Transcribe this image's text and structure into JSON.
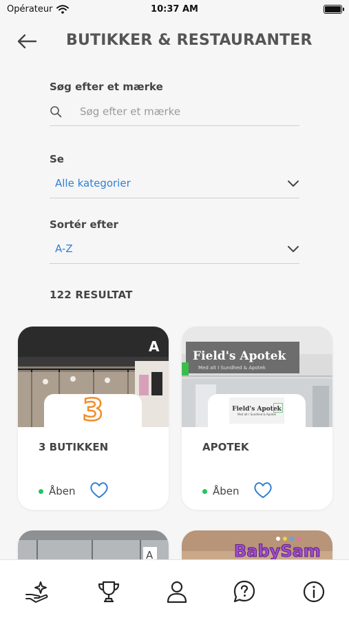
{
  "status_bar": {
    "carrier": "Opérateur",
    "time": "10:37 AM"
  },
  "header": {
    "title": "BUTIKKER & RESTAURANTER"
  },
  "search": {
    "label": "Søg efter et mærke",
    "placeholder": "Søg efter et mærke",
    "value": ""
  },
  "category": {
    "label": "Se",
    "value": "Alle kategorier"
  },
  "sort": {
    "label": "Sortér efter",
    "value": "A-Z"
  },
  "results": {
    "text": "122 RESULTAT"
  },
  "cards": [
    {
      "name": "3 BUTIKKEN",
      "status": "Åben",
      "logo_text": "3"
    },
    {
      "name": "APOTEK",
      "status": "Åben",
      "logo_text": "Field's Apotek",
      "logo_subtext": "Med alt I Sundhed & Apotek",
      "sign_text": "Field's Apotek",
      "sign_subtext": "Med alt I Sundhed & Apotek"
    },
    {
      "sign_text": "A"
    },
    {
      "sign_text": "BabySam"
    }
  ],
  "tabs": [
    {
      "icon": "hand-sparkle-icon"
    },
    {
      "icon": "trophy-icon"
    },
    {
      "icon": "person-icon"
    },
    {
      "icon": "question-icon"
    },
    {
      "icon": "info-icon"
    }
  ],
  "colors": {
    "accent": "#2e7fd3",
    "open_dot": "#22c55e",
    "logo_orange": "#f28c28"
  }
}
